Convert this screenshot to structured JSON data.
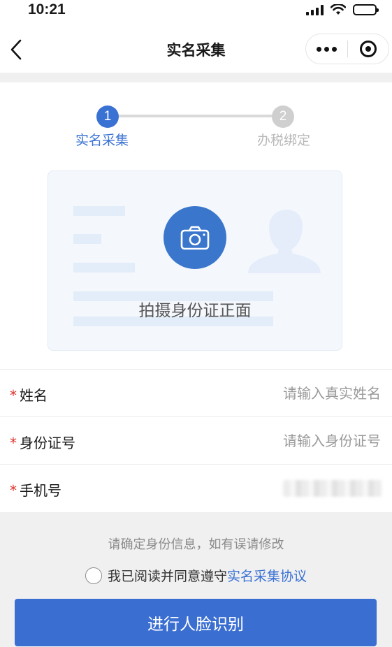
{
  "status_bar": {
    "time": "10:21",
    "icons": [
      "signal-icon",
      "wifi-icon",
      "battery-icon"
    ]
  },
  "nav": {
    "title": "实名采集",
    "back_icon": "chevron-left-icon",
    "menu_icon": "more-dots-icon",
    "close_icon": "target-circle-icon"
  },
  "steps": [
    {
      "number": "1",
      "label": "实名采集",
      "state": "active"
    },
    {
      "number": "2",
      "label": "办税绑定",
      "state": "pending"
    }
  ],
  "id_capture": {
    "label": "拍摄身份证正面",
    "icon": "camera-icon"
  },
  "form": {
    "name": {
      "label": "姓名",
      "required_mark": "*",
      "placeholder": "请输入真实姓名",
      "value": ""
    },
    "id_number": {
      "label": "身份证号",
      "required_mark": "*",
      "placeholder": "请输入身份证号",
      "value": ""
    },
    "phone": {
      "label": "手机号",
      "required_mark": "*"
    }
  },
  "hint": "请确定身份信息，如有误请修改",
  "agreement": {
    "text": "我已阅读并同意遵守",
    "link": "实名采集协议",
    "checked": false
  },
  "submit_label": "进行人脸识别",
  "colors": {
    "primary": "#3a6ed1",
    "required": "#e0312a",
    "inactive": "#cfcfcf"
  }
}
